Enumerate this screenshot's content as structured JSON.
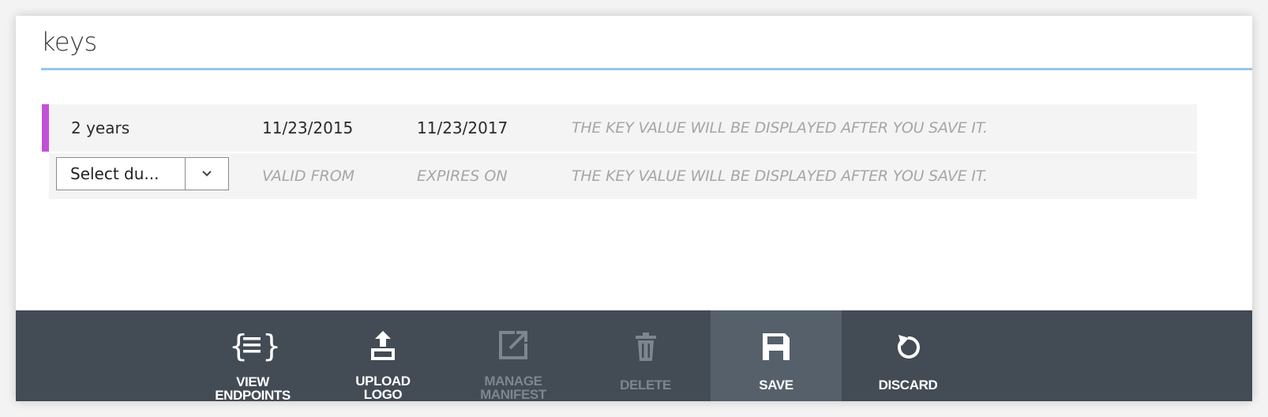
{
  "section": {
    "title": "keys"
  },
  "keys": {
    "existing": {
      "duration": "2 years",
      "valid_from": "11/23/2015",
      "expires_on": "11/23/2017",
      "key_value_note": "THE KEY VALUE WILL BE DISPLAYED AFTER YOU SAVE IT."
    },
    "new": {
      "duration_select_value": "Select du...",
      "valid_from_placeholder": "VALID FROM",
      "expires_on_placeholder": "EXPIRES ON",
      "key_value_note": "THE KEY VALUE WILL BE DISPLAYED AFTER YOU SAVE IT."
    }
  },
  "commandbar": {
    "view_endpoints": "VIEW ENDPOINTS",
    "upload_logo": "UPLOAD LOGO",
    "manage_manifest": "MANAGE MANIFEST",
    "delete": "DELETE",
    "save": "SAVE",
    "discard": "DISCARD"
  },
  "icons": {
    "view_endpoints": "braces-list-icon",
    "upload_logo": "upload-icon",
    "manage_manifest": "external-edit-icon",
    "delete": "trash-icon",
    "save": "floppy-disk-icon",
    "discard": "undo-icon",
    "select": "chevron-down-icon"
  },
  "colors": {
    "accent_row": "#c350d8",
    "title_rule": "#9ac6e6",
    "commandbar_bg": "#434b55",
    "commandbar_active": "#56606b",
    "disabled_text": "#7d858e"
  }
}
